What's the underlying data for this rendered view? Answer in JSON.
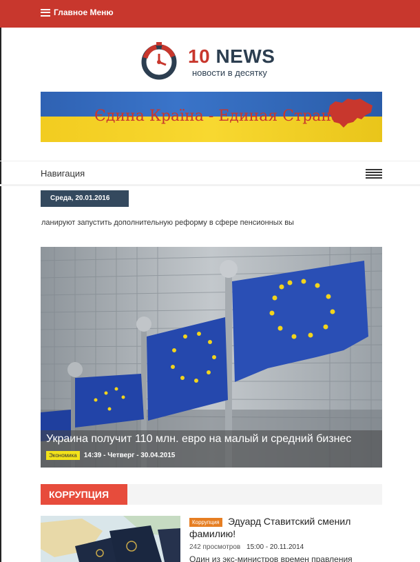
{
  "header": {
    "menu_label": "Главное Меню"
  },
  "logo": {
    "brand_number": "10",
    "brand_word": "NEWS",
    "tagline": "новости в десятку"
  },
  "banner": {
    "slogan": "Єдина Країна - Единая Страна"
  },
  "nav": {
    "label": "Навигация"
  },
  "date": {
    "text": "Среда, 20.01.2016"
  },
  "ticker": {
    "text": "ланируют запустить дополнительную реформу в сфере пенсионных вы"
  },
  "featured": {
    "title": "Украина получит 110 млн. евро на малый и средний бизнес",
    "category": "Экономика",
    "meta": "14:39 - Четверг - 30.04.2015"
  },
  "section": {
    "title": "КОРРУПЦИЯ"
  },
  "article": {
    "category": "Коррупция",
    "title": "Эдуард Ставитский сменил фамилию!",
    "views": "242 просмотров",
    "datetime": "15:00 - 20.11.2014",
    "excerpt": "Один из экс-министров времен правления"
  },
  "colors": {
    "topbar": "#c8372d",
    "date_bg": "#34495e",
    "section_tag": "#e74c3c",
    "article_tag": "#e67e22",
    "featured_tag": "#f3e21a"
  }
}
